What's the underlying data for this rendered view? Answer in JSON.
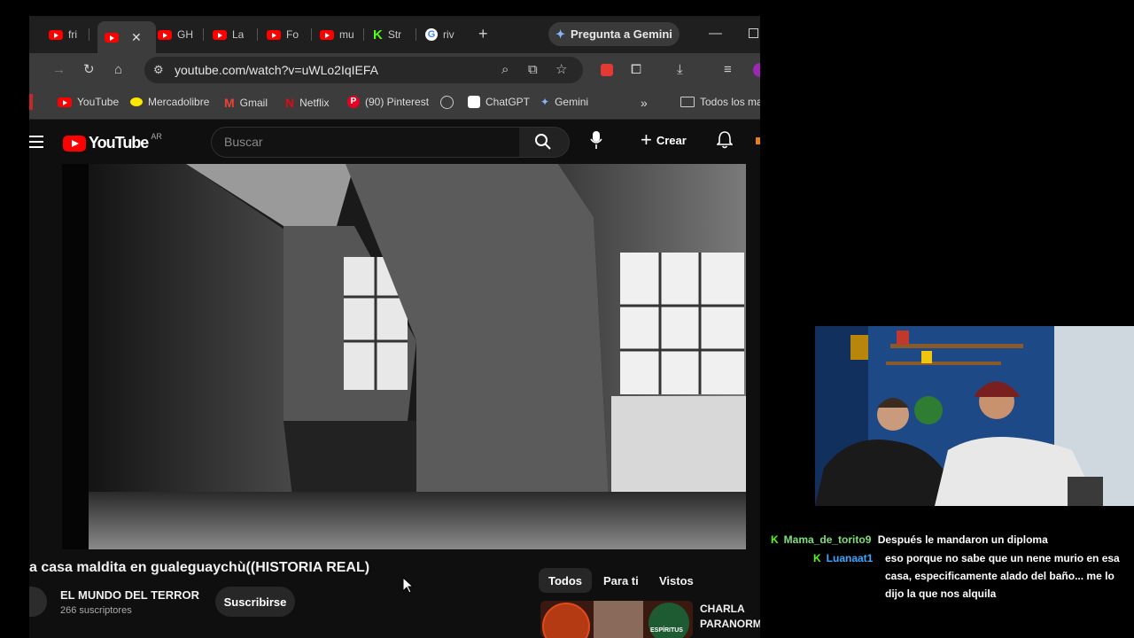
{
  "browser": {
    "tabs": [
      {
        "label": "fri",
        "icon": "youtube-icon"
      },
      {
        "label": "",
        "icon": "youtube-icon",
        "active": true
      },
      {
        "label": "GH",
        "icon": "youtube-icon"
      },
      {
        "label": "La",
        "icon": "youtube-icon"
      },
      {
        "label": "Fo",
        "icon": "youtube-icon"
      },
      {
        "label": "mu",
        "icon": "youtube-icon"
      },
      {
        "label": "Str",
        "icon": "kick-icon"
      },
      {
        "label": "riv",
        "icon": "google-icon"
      }
    ],
    "gemini_button": "Pregunta a Gemini",
    "url": "youtube.com/watch?v=uWLo2IqIEFA",
    "bookmarks": [
      {
        "label": "YouTube",
        "icon": "youtube-icon"
      },
      {
        "label": "Mercadolibre",
        "icon": "mercadolibre-icon"
      },
      {
        "label": "Gmail",
        "icon": "gmail-icon"
      },
      {
        "label": "Netflix",
        "icon": "netflix-icon"
      },
      {
        "label": "(90) Pinterest",
        "icon": "pinterest-icon"
      },
      {
        "label": "",
        "icon": "globe-icon"
      },
      {
        "label": "ChatGPT",
        "icon": "chatgpt-icon"
      },
      {
        "label": "Gemini",
        "icon": "gemini-icon"
      }
    ],
    "all_bookmarks": "Todos los ma"
  },
  "youtube": {
    "logo_text": "YouTube",
    "region": "AR",
    "search_placeholder": "Buscar",
    "create_label": "Crear",
    "video_title": "a casa maldita en gualeguaychù((HISTORIA REAL)",
    "channel_name": "EL MUNDO DEL TERROR",
    "subscribers": "266 suscriptores",
    "subscribe_label": "Suscribirse",
    "filter_chips": [
      "Todos",
      "Para ti",
      "Vistos"
    ],
    "recommended_title_line1": "CHARLA",
    "recommended_title_line2": "PARANORM",
    "recommended_thumb_text": "ESPÍRITUS"
  },
  "chat": {
    "messages": [
      {
        "user": "Mama_de_torito9",
        "user_color": "#7ee07a",
        "text": "Después le mandaron un diploma"
      },
      {
        "user": "Luanaat1",
        "user_color": "#3ea8ff",
        "text_lines": [
          "eso porque no sabe que un nene murio en esa",
          "casa, especificamente alado del baño... me lo",
          "dijo la que nos alquila"
        ]
      }
    ]
  },
  "colors": {
    "youtube_red": "#ff0000",
    "kick_green": "#53fc18",
    "browser_chrome": "#3c3c3c",
    "tab_strip": "#1f1f1f"
  }
}
